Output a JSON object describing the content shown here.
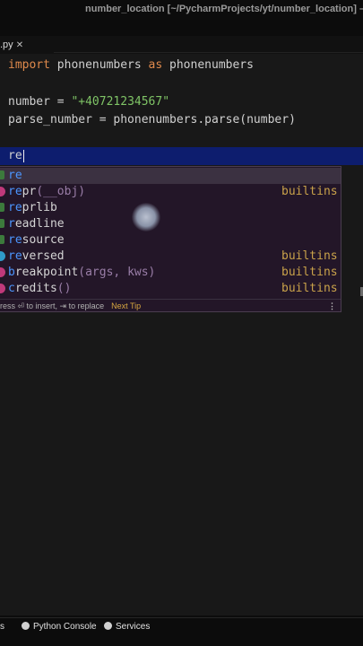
{
  "window": {
    "title": "number_location [~/PycharmProjects/yt/number_location] – ma"
  },
  "tabs": [
    {
      "label": ".py"
    }
  ],
  "editor": {
    "code": {
      "line1_kw1": "import",
      "line1_mid": " phonenumbers ",
      "line1_kw2": "as",
      "line1_end": " phonenumbers",
      "line2_start": "number = ",
      "line2_str": "\"+40721234567\"",
      "line3": "parse_number = phonenumbers.parse(number)",
      "line4": "re"
    }
  },
  "completion": {
    "items": [
      {
        "match": "re",
        "rest": "",
        "params": "",
        "tail": "",
        "icon": "package-icon"
      },
      {
        "match": "re",
        "rest": "pr",
        "params": "(__obj)",
        "tail": "builtins",
        "icon": "method-icon"
      },
      {
        "match": "re",
        "rest": "prlib",
        "params": "",
        "tail": "",
        "icon": "package-icon"
      },
      {
        "match": "r",
        "rest": "eadline",
        "params": "",
        "tail": "",
        "icon": "package-icon"
      },
      {
        "match": "re",
        "rest": "source",
        "params": "",
        "tail": "",
        "icon": "package-icon"
      },
      {
        "match": "re",
        "rest": "versed",
        "params": "",
        "tail": "builtins",
        "icon": "class-icon"
      },
      {
        "match": "b",
        "rest": "reakpoint",
        "params": "(args, kws)",
        "tail": "builtins",
        "icon": "method-icon"
      },
      {
        "match": "c",
        "rest": "redits",
        "params": "()",
        "tail": "builtins",
        "icon": "method-icon"
      }
    ],
    "footer": {
      "hint": "ress ⏎ to insert, ⇥ to replace",
      "tip": "Next Tip"
    }
  },
  "statusbar": {
    "left": "s",
    "python_console": "Python Console",
    "services": "Services"
  },
  "colors": {
    "keyword": "#e08a4c",
    "string": "#7fc466",
    "match_highlight": "#4c96ff",
    "builtins": "#c9a24a",
    "current_line": "#0d1d6e"
  }
}
